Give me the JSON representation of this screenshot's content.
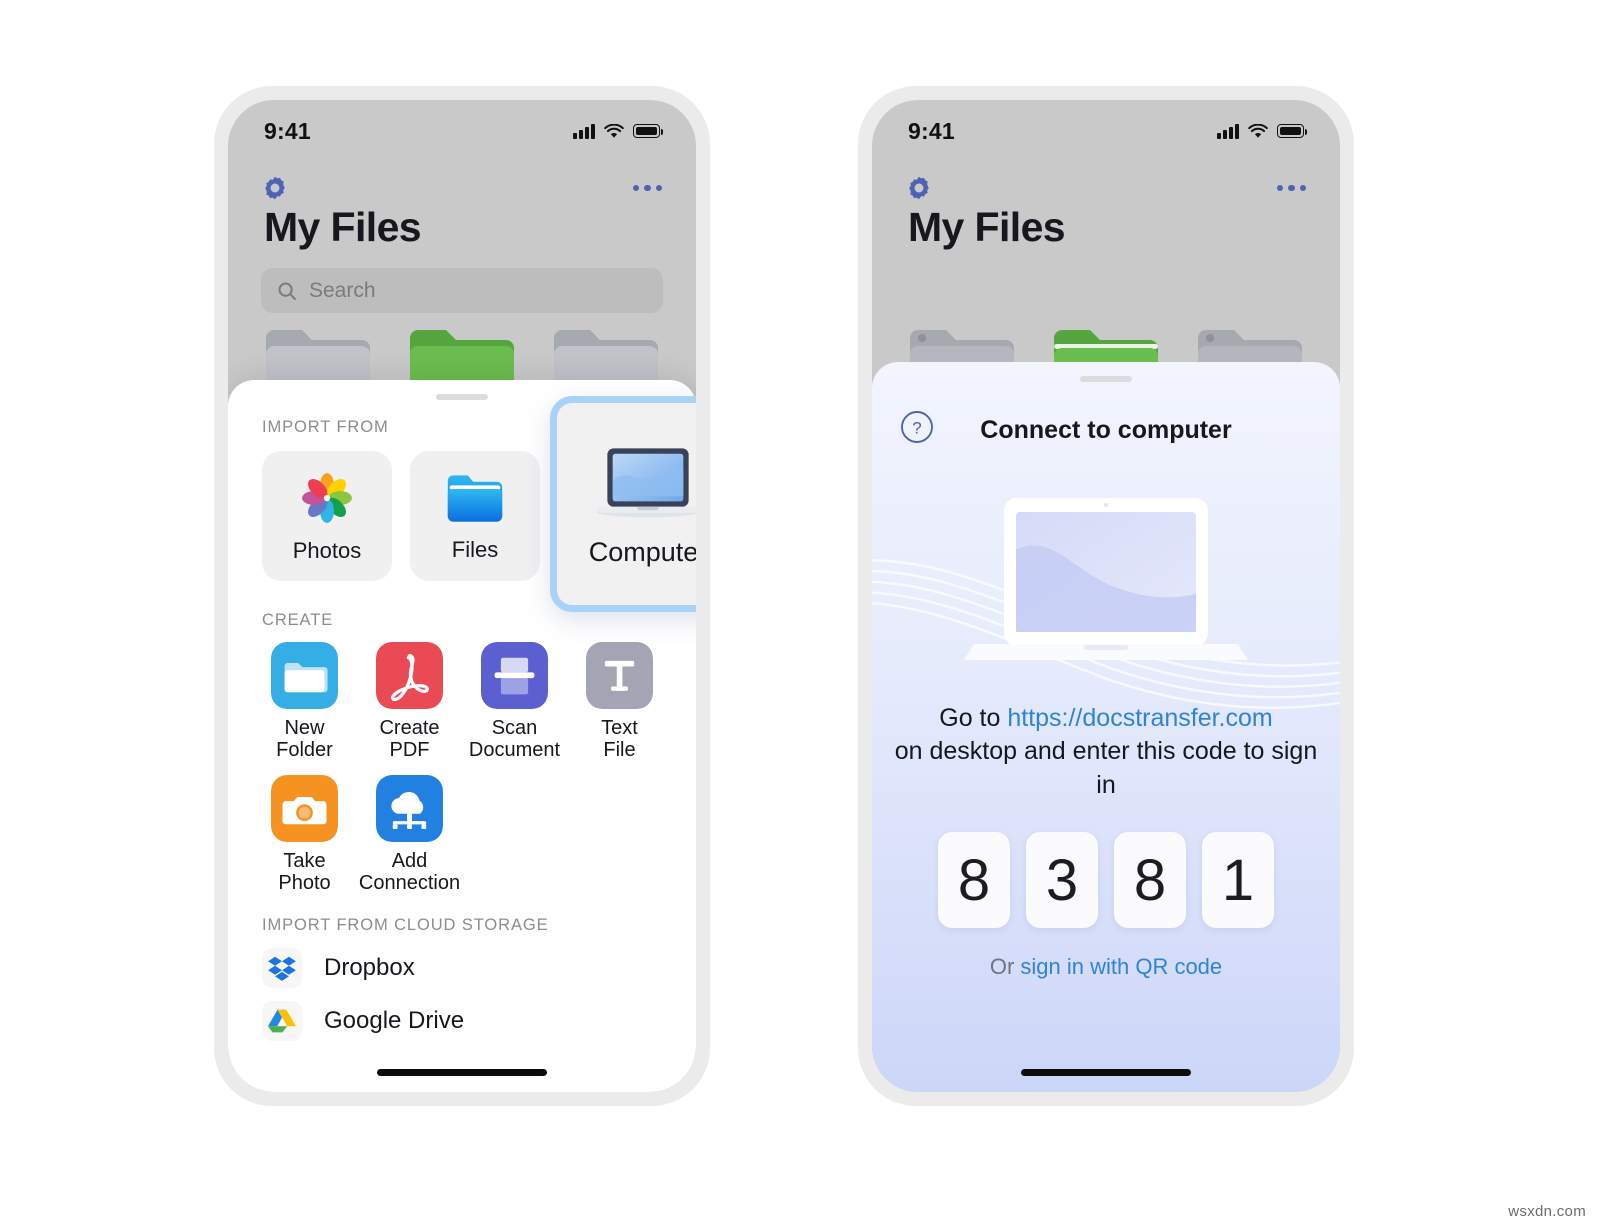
{
  "left_phone": {
    "status": {
      "time": "9:41",
      "signal_icon": "cellular-bars-icon",
      "wifi_icon": "wifi-icon",
      "battery_icon": "battery-full-icon"
    },
    "nav": {
      "settings_icon": "gear-icon",
      "more_icon": "more-horizontal-icon"
    },
    "title": "My Files",
    "search": {
      "placeholder": "Search",
      "icon": "search-icon"
    },
    "sheet": {
      "grabber": "sheet-grabber",
      "import_label": "IMPORT FROM",
      "import_items": [
        {
          "label": "Photos",
          "icon": "photos-app-icon"
        },
        {
          "label": "Files",
          "icon": "files-folder-icon"
        }
      ],
      "highlighted_item": {
        "label": "Computer",
        "icon": "laptop-icon",
        "highlight_color": "#a9d2f7"
      },
      "create_label": "CREATE",
      "create_items": [
        {
          "label": "New\nFolder",
          "icon": "new-folder-icon",
          "color": "#35ade5"
        },
        {
          "label": "Create\nPDF",
          "icon": "pdf-icon",
          "color": "#ea4a53"
        },
        {
          "label": "Scan\nDocument",
          "icon": "scanner-icon",
          "color": "#5b5fd0"
        },
        {
          "label": "Text\nFile",
          "icon": "text-file-icon",
          "color": "#a3a5b5"
        },
        {
          "label": "Take\nPhoto",
          "icon": "camera-icon",
          "color": "#f59220"
        },
        {
          "label": "Add\nConnection",
          "icon": "cloud-connection-icon",
          "color": "#2281e0"
        }
      ],
      "cloud_label": "IMPORT FROM CLOUD STORAGE",
      "cloud_items": [
        {
          "label": "Dropbox",
          "icon": "dropbox-icon"
        },
        {
          "label": "Google Drive",
          "icon": "google-drive-icon"
        }
      ]
    }
  },
  "right_phone": {
    "status": {
      "time": "9:41",
      "signal_icon": "cellular-bars-icon",
      "wifi_icon": "wifi-icon",
      "battery_icon": "battery-full-icon"
    },
    "nav": {
      "settings_icon": "gear-icon",
      "more_icon": "more-horizontal-icon"
    },
    "title": "My Files",
    "connect": {
      "help_icon": "help-circle-icon",
      "title": "Connect to computer",
      "illustration": "laptop-illustration",
      "instruction_prefix": "Go to ",
      "url": "https://docstransfer.com",
      "instruction_suffix": "on desktop and enter this code to sign in",
      "code_digits": [
        "8",
        "3",
        "8",
        "1"
      ],
      "qr_prefix": "Or ",
      "qr_link": "sign in with QR code"
    }
  },
  "watermark": "wsxdn.com"
}
